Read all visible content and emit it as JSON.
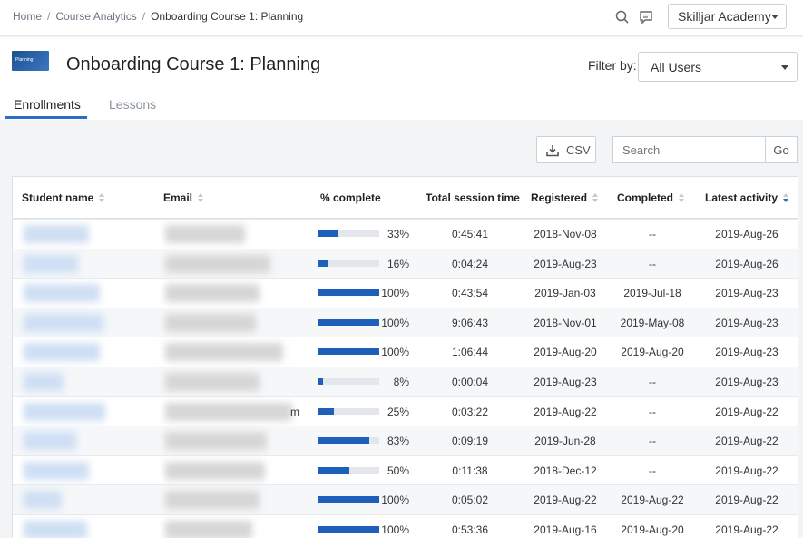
{
  "breadcrumb": [
    "Home",
    "Course Analytics",
    "Onboarding Course 1: Planning"
  ],
  "account": {
    "label": "Skilljar Academy"
  },
  "course": {
    "title": "Onboarding Course 1: Planning",
    "thumb_text": "Planning"
  },
  "filter": {
    "label": "Filter by:",
    "selected": "All Users"
  },
  "tabs": [
    {
      "label": "Enrollments",
      "active": true
    },
    {
      "label": "Lessons",
      "active": false
    }
  ],
  "toolbar": {
    "csv_label": "CSV",
    "search_placeholder": "Search",
    "go_label": "Go"
  },
  "columns": [
    "Student name",
    "Email",
    "% complete",
    "Total session time",
    "Registered",
    "Completed",
    "Latest activity"
  ],
  "rows": [
    {
      "pct": 33,
      "pct_label": "33%",
      "time": "0:45:41",
      "registered": "2018-Nov-08",
      "completed": "--",
      "latest": "2019-Aug-26",
      "email_tail": ""
    },
    {
      "pct": 16,
      "pct_label": "16%",
      "time": "0:04:24",
      "registered": "2019-Aug-23",
      "completed": "--",
      "latest": "2019-Aug-26",
      "email_tail": ""
    },
    {
      "pct": 100,
      "pct_label": "100%",
      "time": "0:43:54",
      "registered": "2019-Jan-03",
      "completed": "2019-Jul-18",
      "latest": "2019-Aug-23",
      "email_tail": ""
    },
    {
      "pct": 100,
      "pct_label": "100%",
      "time": "9:06:43",
      "registered": "2018-Nov-01",
      "completed": "2019-May-08",
      "latest": "2019-Aug-23",
      "email_tail": ""
    },
    {
      "pct": 100,
      "pct_label": "100%",
      "time": "1:06:44",
      "registered": "2019-Aug-20",
      "completed": "2019-Aug-20",
      "latest": "2019-Aug-23",
      "email_tail": ""
    },
    {
      "pct": 8,
      "pct_label": "8%",
      "time": "0:00:04",
      "registered": "2019-Aug-23",
      "completed": "--",
      "latest": "2019-Aug-23",
      "email_tail": ""
    },
    {
      "pct": 25,
      "pct_label": "25%",
      "time": "0:03:22",
      "registered": "2019-Aug-22",
      "completed": "--",
      "latest": "2019-Aug-22",
      "email_tail": "m"
    },
    {
      "pct": 83,
      "pct_label": "83%",
      "time": "0:09:19",
      "registered": "2019-Jun-28",
      "completed": "--",
      "latest": "2019-Aug-22",
      "email_tail": ""
    },
    {
      "pct": 50,
      "pct_label": "50%",
      "time": "0:11:38",
      "registered": "2018-Dec-12",
      "completed": "--",
      "latest": "2019-Aug-22",
      "email_tail": ""
    },
    {
      "pct": 100,
      "pct_label": "100%",
      "time": "0:05:02",
      "registered": "2019-Aug-22",
      "completed": "2019-Aug-22",
      "latest": "2019-Aug-22",
      "email_tail": ""
    },
    {
      "pct": 100,
      "pct_label": "100%",
      "time": "0:53:36",
      "registered": "2019-Aug-16",
      "completed": "2019-Aug-20",
      "latest": "2019-Aug-22",
      "email_tail": ""
    }
  ],
  "colors": {
    "accent": "#2a6ec6",
    "bar_fill": "#1d5fb9",
    "bar_track": "#e3e6ea"
  }
}
